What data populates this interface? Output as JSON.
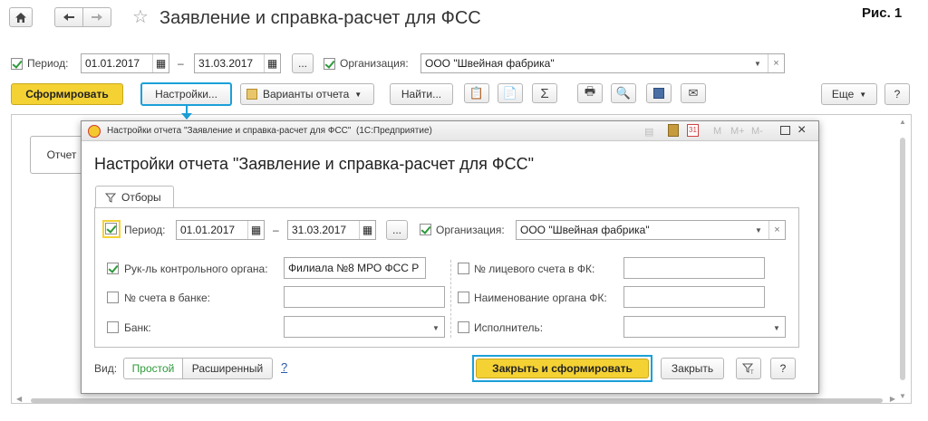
{
  "figure_label": "Рис. 1",
  "main": {
    "title": "Заявление и справка-расчет для ФСС",
    "period_label": "Период:",
    "date_from": "01.01.2017",
    "date_sep": "–",
    "date_to": "31.03.2017",
    "ellipsis": "...",
    "org_label": "Организация:",
    "org_value": "ООО \"Швейная фабрика\"",
    "generate_button": "Сформировать",
    "settings_button": "Настройки...",
    "variants_button": "Варианты отчета",
    "find_button": "Найти...",
    "sum_icon_glyph": "Σ",
    "more_button": "Еще",
    "help_button": "?",
    "report_tab": "Отчет"
  },
  "dialog": {
    "window_title": "Настройки отчета \"Заявление и справка-расчет для ФСС\"  (1С:Предприятие)",
    "title_glyphs": {
      "m": "M",
      "mplus": "M+",
      "mminus": "M-"
    },
    "heading": "Настройки отчета \"Заявление и справка-расчет для ФСС\"",
    "tab_filters": "Отборы",
    "period_label": "Период:",
    "date_from": "01.01.2017",
    "date_sep": "–",
    "date_to": "31.03.2017",
    "ellipsis": "...",
    "org_label": "Организация:",
    "org_value": "ООО \"Швейная фабрика\"",
    "fields": {
      "head_control_label": "Рук-ль контрольного органа:",
      "head_control_value": "Филиала №8 МРО ФСС Р",
      "bank_account_label": "№ счета в банке:",
      "bank_label": "Банк:",
      "personal_account_label": "№ лицевого счета в ФК:",
      "fk_name_label": "Наименование органа ФК:",
      "executor_label": "Исполнитель:"
    },
    "view_label": "Вид:",
    "view_simple": "Простой",
    "view_extended": "Расширенный",
    "help_link": "?",
    "close_generate_button": "Закрыть и сформировать",
    "close_button": "Закрыть",
    "help_button": "?"
  },
  "colors": {
    "accent_yellow": "#f4d234",
    "highlight_blue": "#1aa0d8",
    "check_green": "#2e9a3a",
    "link_blue": "#2a5aa8"
  }
}
